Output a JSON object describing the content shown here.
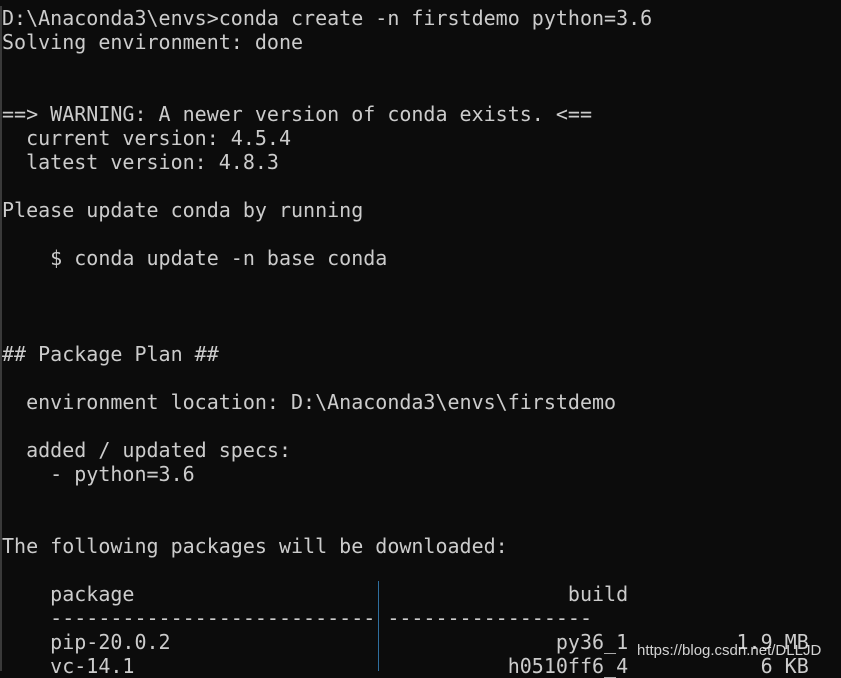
{
  "terminal": {
    "lines": [
      "D:\\Anaconda3\\envs>conda create -n firstdemo python=3.6",
      "Solving environment: done",
      "",
      "",
      "==> WARNING: A newer version of conda exists. <==",
      "  current version: 4.5.4",
      "  latest version: 4.8.3",
      "",
      "Please update conda by running",
      "",
      "    $ conda update -n base conda",
      "",
      "",
      "",
      "## Package Plan ##",
      "",
      "  environment location: D:\\Anaconda3\\envs\\firstdemo",
      "",
      "  added / updated specs:",
      "    - python=3.6",
      "",
      "",
      "The following packages will be downloaded:",
      "",
      "    package                                    build",
      "    --------------------------- -----------------",
      "    pip-20.0.2                                py36_1         1.9 MB",
      "    vc-14.1                               h0510ff6_4           6 KB"
    ]
  },
  "watermark": "https://blog.csdn.net/DLLJD",
  "colors": {
    "background": "#0c0c0c",
    "text": "#cccccc",
    "separator": "#2f6f9f"
  }
}
